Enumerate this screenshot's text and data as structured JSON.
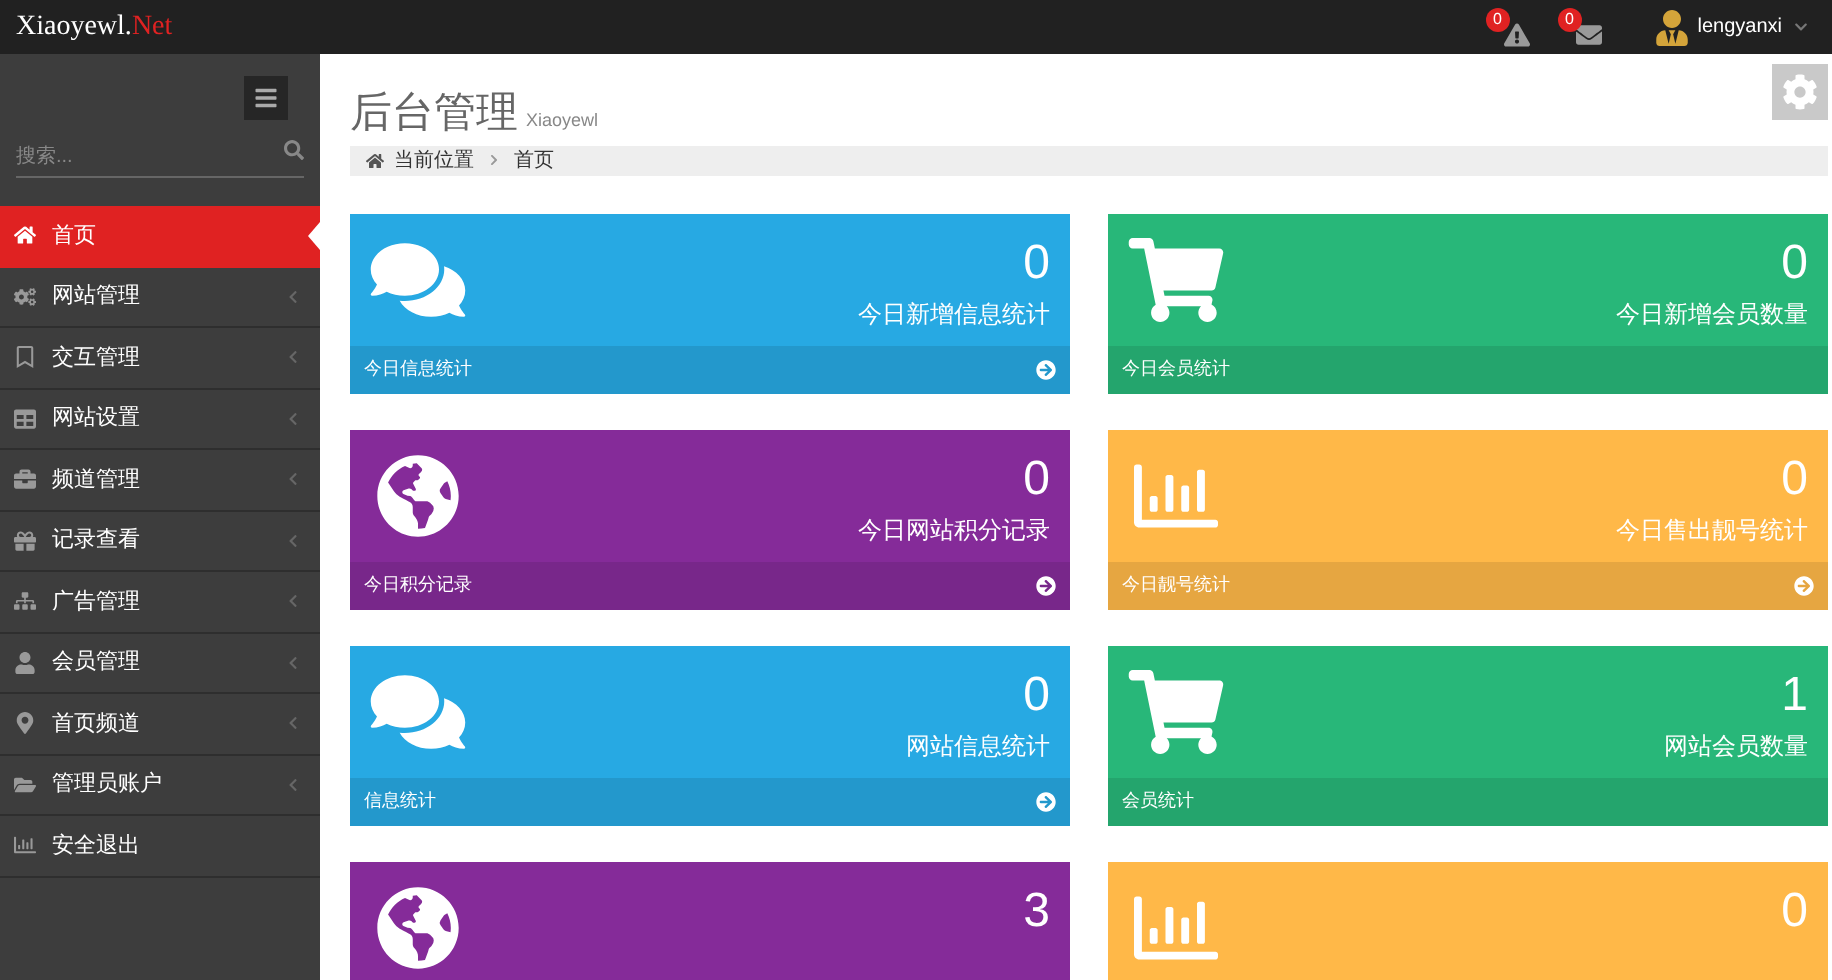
{
  "header": {
    "logo": {
      "main": "Xiaoyewl.",
      "accent": "Net"
    },
    "notifications": [
      {
        "count": "0"
      },
      {
        "count": "0"
      }
    ],
    "user": {
      "name": "lengyanxi"
    }
  },
  "sidebar": {
    "search": {
      "placeholder": "搜索..."
    },
    "items": [
      {
        "label": "首页",
        "selected": true,
        "has_submenu": false
      },
      {
        "label": "网站管理",
        "selected": false,
        "has_submenu": true
      },
      {
        "label": "交互管理",
        "selected": false,
        "has_submenu": true
      },
      {
        "label": "网站设置",
        "selected": false,
        "has_submenu": true
      },
      {
        "label": "频道管理",
        "selected": false,
        "has_submenu": true
      },
      {
        "label": "记录查看",
        "selected": false,
        "has_submenu": true
      },
      {
        "label": "广告管理",
        "selected": false,
        "has_submenu": true
      },
      {
        "label": "会员管理",
        "selected": false,
        "has_submenu": true
      },
      {
        "label": "首页频道",
        "selected": false,
        "has_submenu": true
      },
      {
        "label": "管理员账户",
        "selected": false,
        "has_submenu": true
      },
      {
        "label": "安全退出",
        "selected": false,
        "has_submenu": false
      }
    ]
  },
  "page": {
    "title": "后台管理",
    "subtitle": "Xiaoyewl",
    "breadcrumb": [
      "当前位置",
      "首页"
    ]
  },
  "cards": [
    {
      "value": "0",
      "label": "今日新增信息统计",
      "footer": "今日信息统计",
      "color": "#27a9e3",
      "link_arrow": true
    },
    {
      "value": "0",
      "label": "今日新增会员数量",
      "footer": "今日会员统计",
      "color": "#28b779",
      "link_arrow": false
    },
    {
      "value": "0",
      "label": "今日网站积分记录",
      "footer": "今日积分记录",
      "color": "#852b99",
      "link_arrow": true
    },
    {
      "value": "0",
      "label": "今日售出靓号统计",
      "footer": "今日靓号统计",
      "color": "#ffb848",
      "link_arrow": true
    },
    {
      "value": "0",
      "label": "网站信息统计",
      "footer": "信息统计",
      "color": "#27a9e3",
      "link_arrow": true
    },
    {
      "value": "1",
      "label": "网站会员数量",
      "footer": "会员统计",
      "color": "#28b779",
      "link_arrow": false
    },
    {
      "value": "3",
      "color": "#852b99"
    },
    {
      "value": "0",
      "color": "#ffb848"
    }
  ]
}
